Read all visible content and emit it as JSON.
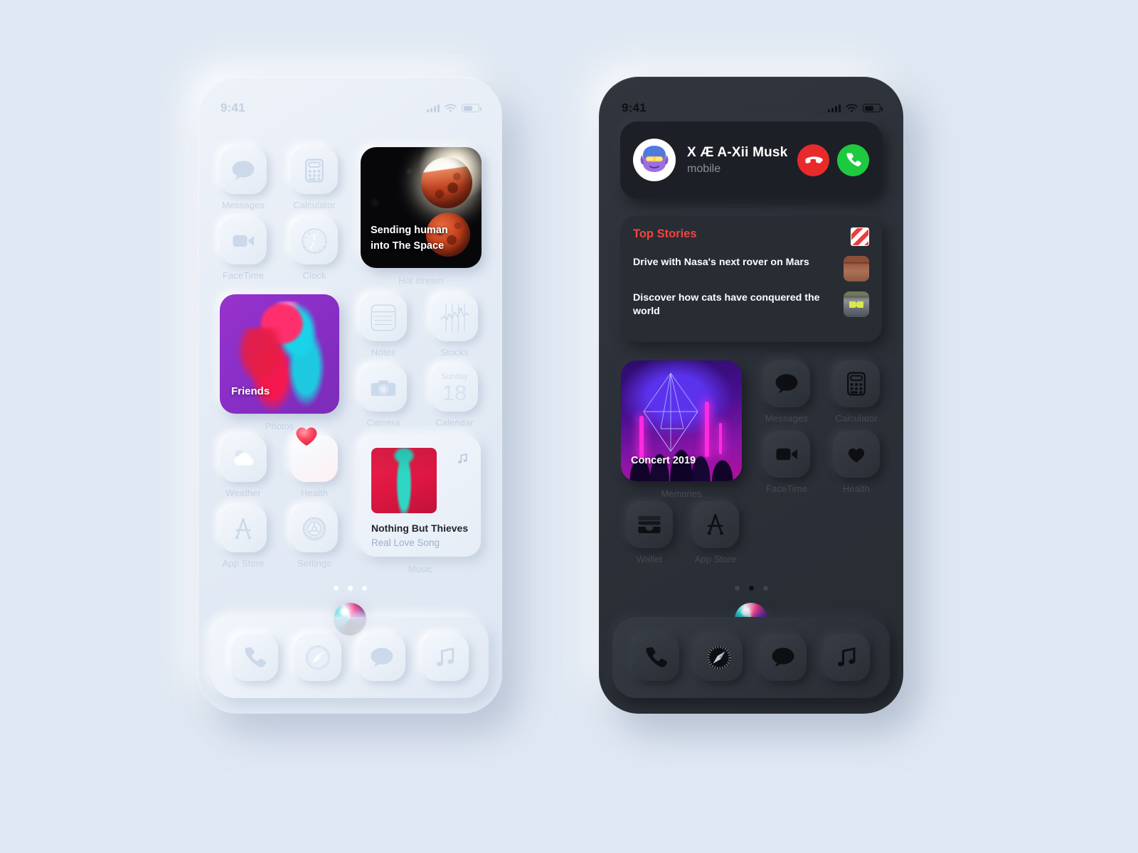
{
  "canvas": {
    "background": "#e0e8f3"
  },
  "phones": {
    "light": {
      "theme_label": "light",
      "status": {
        "time": "9:41",
        "signal_icon": "cellular-bars-icon",
        "wifi_icon": "wifi-icon",
        "battery_icon": "battery-icon"
      },
      "widgets": {
        "hot_stream": {
          "headline": "Sending human into The Space",
          "label": "Hot stream"
        },
        "photos": {
          "tag": "Friends",
          "label": "Photos"
        },
        "music": {
          "artist": "Nothing But Thieves",
          "song": "Real Love Song",
          "label": "Music",
          "note_icon": "music-note-icon"
        }
      },
      "apps": [
        {
          "name": "Messages",
          "icon": "messages-bubble-icon"
        },
        {
          "name": "Calculator",
          "icon": "calculator-icon"
        },
        {
          "name": "FaceTime",
          "icon": "facetime-video-icon"
        },
        {
          "name": "Clock",
          "icon": "clock-icon"
        },
        {
          "name": "Notes",
          "icon": "notes-icon"
        },
        {
          "name": "Stocks",
          "icon": "stocks-chart-icon"
        },
        {
          "name": "Camera",
          "icon": "camera-icon"
        },
        {
          "name": "Calendar",
          "icon": "calendar-icon"
        },
        {
          "name": "Weather",
          "icon": "weather-cloud-sun-icon"
        },
        {
          "name": "Health",
          "icon": "health-heart-icon"
        },
        {
          "name": "App Store",
          "icon": "app-store-icon"
        },
        {
          "name": "Settings",
          "icon": "settings-gear-icon"
        }
      ],
      "calendar_icon": {
        "weekday": "Sunday",
        "day": "18"
      },
      "page_dots": {
        "count": 3,
        "active_index": 1
      },
      "siri_icon": "siri-orb-icon",
      "dock": [
        {
          "name": "Phone",
          "icon": "phone-handset-icon"
        },
        {
          "name": "Safari",
          "icon": "safari-compass-icon"
        },
        {
          "name": "Messages",
          "icon": "messages-bubble-icon"
        },
        {
          "name": "Music",
          "icon": "music-note-icon"
        }
      ]
    },
    "dark": {
      "theme_label": "dark",
      "status": {
        "time": "9:41",
        "signal_icon": "cellular-bars-icon",
        "wifi_icon": "wifi-icon",
        "battery_icon": "battery-icon"
      },
      "call": {
        "name": "X Æ A-Xii Musk",
        "line": "mobile",
        "avatar_icon": "memoji-avatar",
        "decline_label": "Decline",
        "accept_label": "Accept",
        "decline_color": "#e82a2a",
        "accept_color": "#1ec93f"
      },
      "news": {
        "title": "Top Stories",
        "title_color": "#f0463f",
        "source_icon": "news-flag-icon",
        "stories": [
          {
            "headline": "Drive with Nasa's next rover on Mars",
            "thumb": "mars-rover-thumb"
          },
          {
            "headline": "Discover how cats have conquered the world",
            "thumb": "cat-thumb"
          }
        ]
      },
      "widgets": {
        "memories": {
          "tag": "Concert 2019",
          "label": "Memories"
        }
      },
      "apps": [
        {
          "name": "Messages",
          "icon": "messages-bubble-icon"
        },
        {
          "name": "Calculator",
          "icon": "calculator-icon"
        },
        {
          "name": "FaceTime",
          "icon": "facetime-video-icon"
        },
        {
          "name": "Health",
          "icon": "health-heart-icon"
        },
        {
          "name": "Wallet",
          "icon": "wallet-icon"
        },
        {
          "name": "App Store",
          "icon": "app-store-icon"
        }
      ],
      "page_dots": {
        "count": 3,
        "active_index": 1
      },
      "siri_icon": "siri-orb-icon",
      "dock": [
        {
          "name": "Phone",
          "icon": "phone-handset-icon"
        },
        {
          "name": "Safari",
          "icon": "safari-compass-icon"
        },
        {
          "name": "Messages",
          "icon": "messages-bubble-icon"
        },
        {
          "name": "Music",
          "icon": "music-note-icon"
        }
      ]
    }
  }
}
